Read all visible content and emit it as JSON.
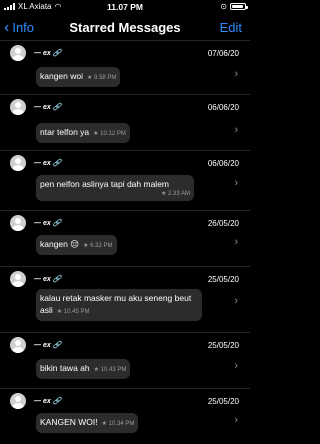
{
  "status": {
    "carrier": "XL Axiata",
    "time": "11.07 PM",
    "battery_level": 0.9
  },
  "nav": {
    "back_label": "Info",
    "title": "Starred Messages",
    "edit_label": "Edit"
  },
  "messages": [
    {
      "sender": "— ex 🔗",
      "date": "07/06/20",
      "text": "kangen woi",
      "meta": "★ 9.58 PM"
    },
    {
      "sender": "— ex 🔗",
      "date": "06/06/20",
      "text": "ntar telfon ya",
      "meta": "★ 10.12 PM"
    },
    {
      "sender": "— ex 🔗",
      "date": "06/06/20",
      "text": "pen nelfon aslinya tapi dah malem",
      "meta": "★ 2.33 AM"
    },
    {
      "sender": "— ex 🔗",
      "date": "26/05/20",
      "text": "kangen 😔",
      "meta": "★ 6.32 PM"
    },
    {
      "sender": "— ex 🔗",
      "date": "25/05/20",
      "text": "kalau retak masker mu aku seneng beut asli",
      "meta": "★ 10.45 PM"
    },
    {
      "sender": "— ex 🔗",
      "date": "25/05/20",
      "text": "bikin tawa ah",
      "meta": "★ 10.43 PM"
    },
    {
      "sender": "— ex 🔗",
      "date": "25/05/20",
      "text": "KANGEN WOI!",
      "meta": "★ 10.34 PM"
    }
  ]
}
